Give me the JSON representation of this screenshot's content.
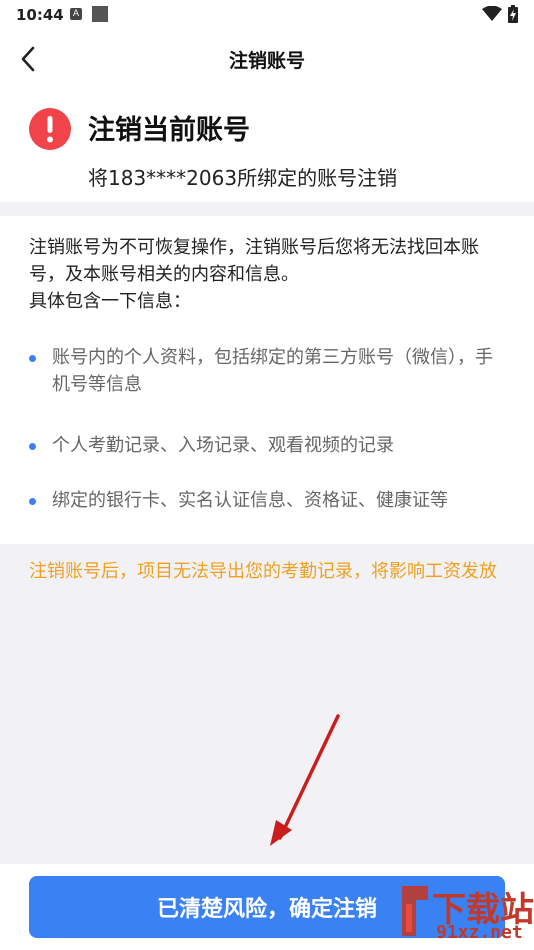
{
  "status_bar": {
    "time": "10:44",
    "badge": "A"
  },
  "nav": {
    "title": "注销账号"
  },
  "header": {
    "title": "注销当前账号",
    "subtitle": "将183****2063所绑定的账号注销"
  },
  "info": {
    "intro_line1": "注销账号为不可恢复操作，注销账号后您将无法找回本账号，及本账号相关的内容和信息。",
    "intro_line2": "具体包含一下信息：",
    "bullets": [
      "账号内的个人资料，包括绑定的第三方账号（微信），手机号等信息",
      "个人考勤记录、入场记录、观看视频的记录",
      "绑定的银行卡、实名认证信息、资格证、健康证等"
    ]
  },
  "warning_note": "注销账号后，项目无法导出您的考勤记录，将影响工资发放",
  "confirm_button": {
    "label": "已清楚风险，确定注销"
  },
  "watermark": {
    "text_main": "下载站",
    "text_url": "91xz.net"
  },
  "colors": {
    "primary": "#3a82f4",
    "danger": "#f0434a",
    "warning": "#f0a020",
    "background": "#f2f2f6"
  }
}
